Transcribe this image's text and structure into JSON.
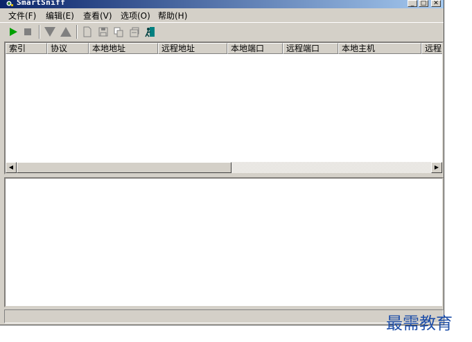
{
  "window": {
    "title": "SmartSniff"
  },
  "titlebar_buttons": {
    "minimize": "_",
    "maximize": "□",
    "close": "✕"
  },
  "menu": {
    "items": [
      {
        "label": "文件(F)"
      },
      {
        "label": "编辑(E)"
      },
      {
        "label": "查看(V)"
      },
      {
        "label": "选项(O)"
      },
      {
        "label": "帮助(H)"
      }
    ]
  },
  "toolbar": {
    "buttons": [
      "play-icon",
      "stop-icon",
      "filter-down-icon",
      "filter-up-icon",
      "new-file-icon",
      "save-icon",
      "copy-icon",
      "properties-icon",
      "exit-icon"
    ],
    "colors": {
      "play": "#00a000",
      "disabled": "#808080",
      "exit": "#008080"
    }
  },
  "table": {
    "columns": [
      {
        "label": "索引"
      },
      {
        "label": "协议"
      },
      {
        "label": "本地地址"
      },
      {
        "label": "远程地址"
      },
      {
        "label": "本地端口"
      },
      {
        "label": "远程端口"
      },
      {
        "label": "本地主机"
      },
      {
        "label": "远程"
      }
    ],
    "rows": []
  },
  "scrollbar": {
    "left_arrow": "◀",
    "right_arrow": "▶"
  },
  "status": {
    "text": ""
  },
  "watermark": {
    "text": "最需教育"
  }
}
